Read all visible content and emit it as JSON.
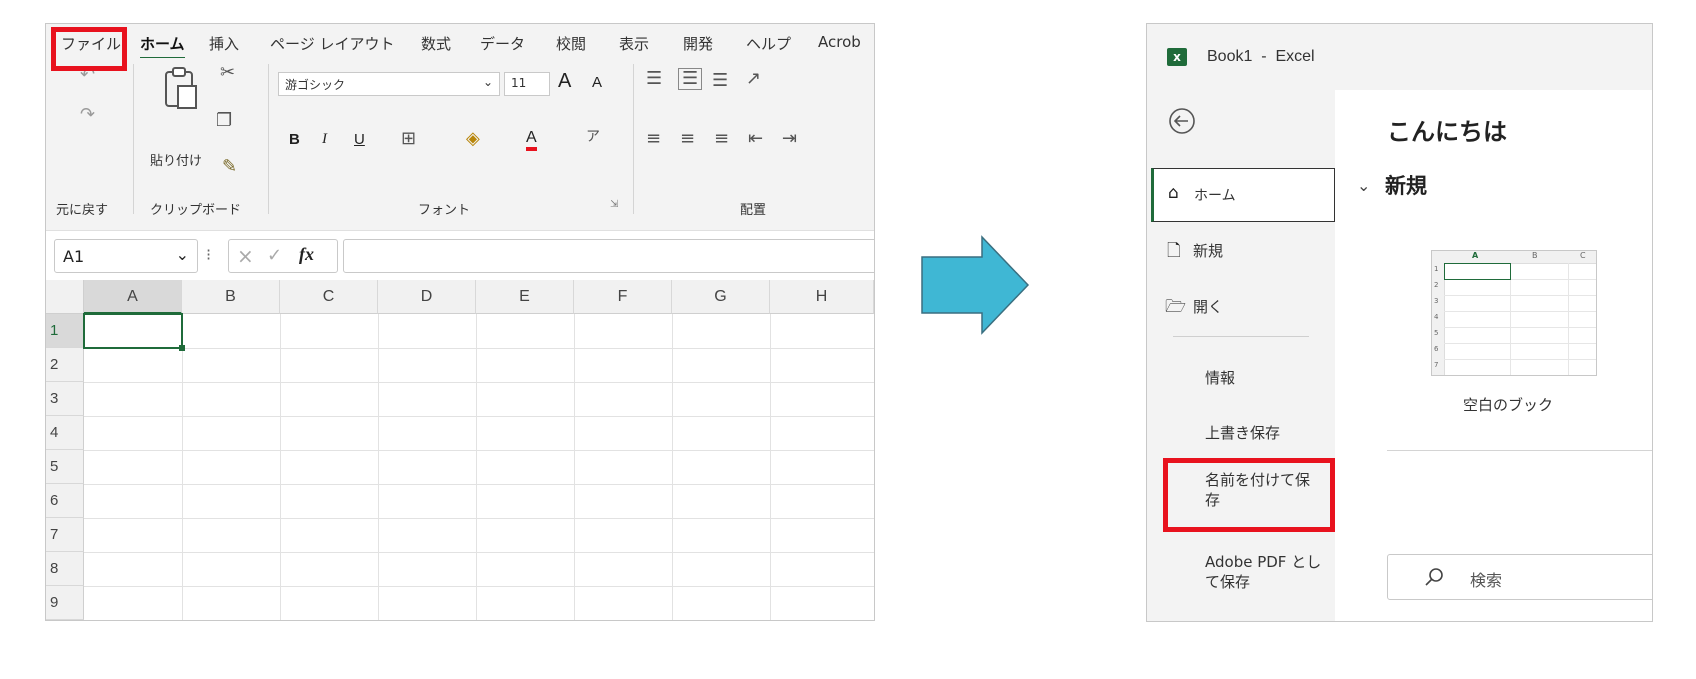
{
  "excel": {
    "menu_tabs": [
      "ファイル",
      "ホーム",
      "挿入",
      "ページ レイアウト",
      "数式",
      "データ",
      "校閲",
      "表示",
      "開発",
      "ヘルプ",
      "Acrob"
    ],
    "active_tab": "ホーム",
    "ribbon": {
      "groups": {
        "undo": "元に戻す",
        "clipboard": "クリップボード",
        "font": "フォント",
        "alignment": "配置"
      },
      "paste_label": "貼り付け",
      "font_name": "游ゴシック",
      "font_size": "11",
      "bold": "B",
      "italic": "I",
      "underline": "U",
      "grow_font": "A",
      "shrink_font": "A",
      "font_color": "A"
    },
    "name_box": "A1",
    "fx": "fx",
    "columns": [
      "A",
      "B",
      "C",
      "D",
      "E",
      "F",
      "G",
      "H"
    ],
    "rows": [
      "1",
      "2",
      "3",
      "4",
      "5",
      "6",
      "7",
      "8",
      "9"
    ],
    "accent": "#1f6b3a"
  },
  "backstage": {
    "app_badge": "x",
    "window_title": "Book1  -  Excel",
    "nav": {
      "home": "ホーム",
      "new": "新規",
      "open": "開く",
      "info": "情報",
      "save": "上書き保存",
      "save_as": "名前を付けて保存",
      "save_as_line2": "存",
      "save_as_line1": "名前を付けて保",
      "save_pdf_line1": "Adobe PDF とし",
      "save_pdf_line2": "て保存"
    },
    "greeting": "こんにちは",
    "section_new": "新規",
    "template_label": "空白のブック",
    "thumb_cols": [
      "A",
      "B",
      "C"
    ],
    "thumb_rows": [
      "1",
      "2",
      "3",
      "4",
      "5",
      "6",
      "7"
    ],
    "search_placeholder": "検索"
  },
  "colors": {
    "highlight": "#e8121e",
    "arrow": "#3fb7d4",
    "excel_green": "#1f6b3a"
  }
}
